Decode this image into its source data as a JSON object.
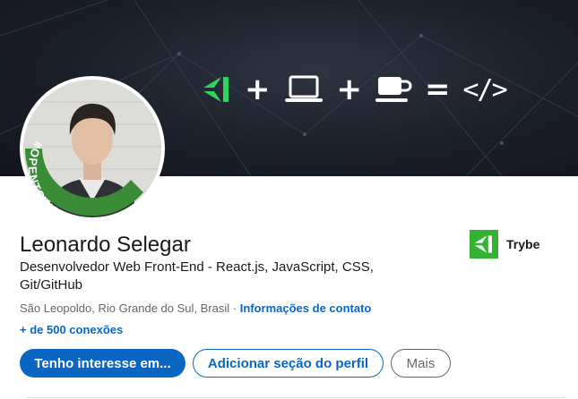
{
  "banner": {
    "plus_1": "+",
    "plus_2": "+",
    "equals": "=",
    "code_symbol": "</>"
  },
  "avatar": {
    "badge_text": "#OPENTOWORK",
    "badge_color": "#3b8c37"
  },
  "profile": {
    "name": "Leonardo Selegar",
    "headline": "Desenvolvedor Web Front-End - React.js, JavaScript, CSS, Git/GitHub",
    "location": "São Leopoldo, Rio Grande do Sul, Brasil",
    "separator": " · ",
    "contact_link": "Informações de contato",
    "connections": "+ de 500 conexões"
  },
  "company": {
    "name": "Trybe",
    "logo_color": "#34b233"
  },
  "actions": {
    "primary": "Tenho interesse em...",
    "secondary": "Adicionar seção do perfil",
    "more": "Mais"
  },
  "colors": {
    "accent": "#0a66c2",
    "banner_bg": "#1b1f29"
  }
}
